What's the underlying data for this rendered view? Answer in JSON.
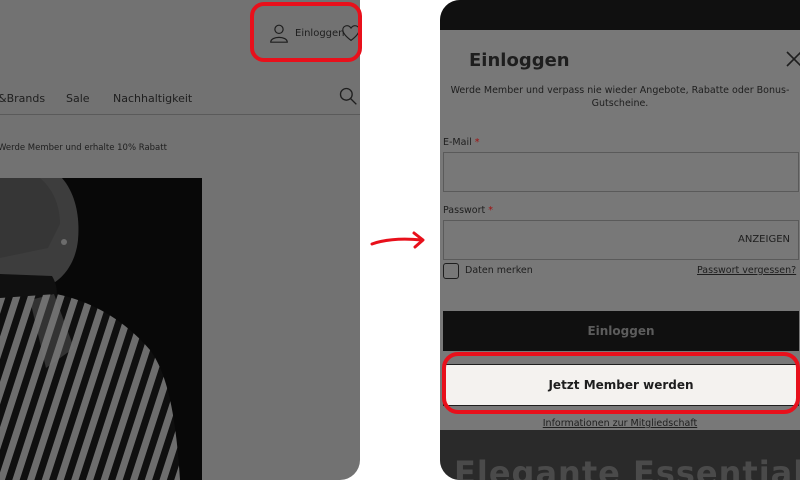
{
  "left": {
    "header": {
      "login_label": "Einloggen"
    },
    "nav": {
      "items": [
        "&Brands",
        "Sale",
        "Nachhaltigkeit"
      ]
    },
    "promo_text": "Werde Member und erhalte 10% Rabatt"
  },
  "modal": {
    "title": "Einloggen",
    "subtitle": "Werde Member und verpass nie wieder Angebote, Rabatte oder Bonus-Gutscheine.",
    "email_label": "E-Mail",
    "password_label": "Passwort",
    "required_mark": "*",
    "show_password": "ANZEIGEN",
    "remember_label": "Daten merken",
    "forgot_link": "Passwort vergessen?",
    "login_button": "Einloggen",
    "member_button": "Jetzt Member werden",
    "info_link": "Informationen zur Mitgliedschaft"
  },
  "right_bottom": {
    "banner_text": "Elegante Essentials"
  },
  "colors": {
    "highlight": "#e8101b",
    "overlay": "#727272",
    "button_dark": "#101010",
    "button_light": "#f4f2ef"
  }
}
